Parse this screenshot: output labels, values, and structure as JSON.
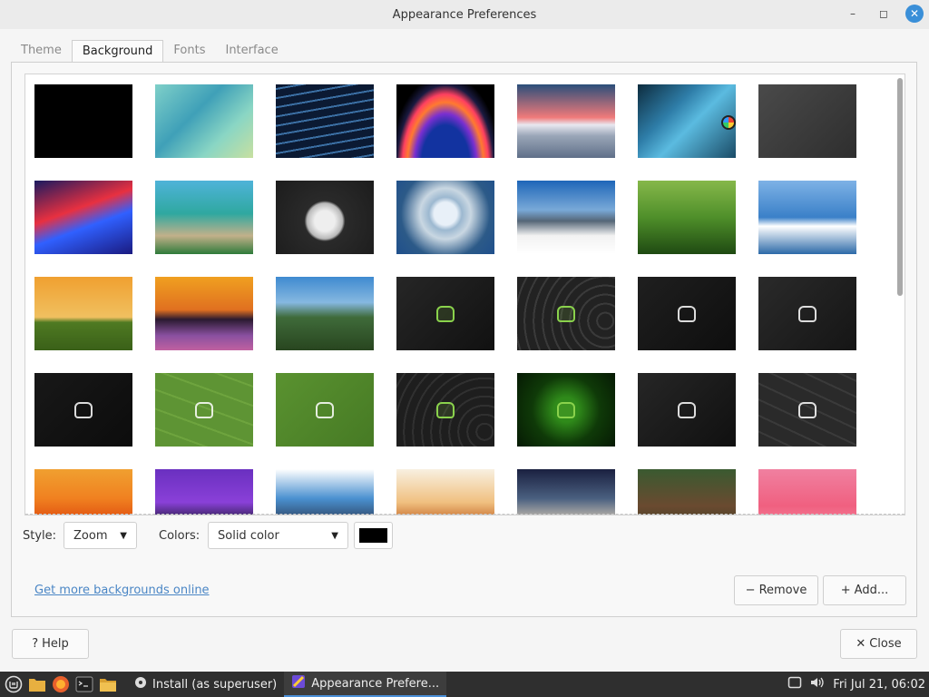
{
  "window": {
    "title": "Appearance Preferences",
    "minimize": "–",
    "maximize": "◻",
    "close": "✕"
  },
  "tabs": [
    {
      "label": "Theme",
      "active": false
    },
    {
      "label": "Background",
      "active": true
    },
    {
      "label": "Fonts",
      "active": false
    },
    {
      "label": "Interface",
      "active": false
    }
  ],
  "thumbnails": [
    {
      "bg": "#000000"
    },
    {
      "bg": "linear-gradient(135deg,#7fd0c9 0%,#3fa0b8 40%,#8ad6c4 70%,#c8e0a0 100%)"
    },
    {
      "bg": "repeating-linear-gradient(170deg,#0b1a33 0 4px,#3b6fa3 4px 6px,#0b1a33 6px 10px)"
    },
    {
      "bg": "radial-gradient(ellipse at 50% 110%,#1233a0 0 35%,#7a2fd0 45%,#ff7a30 55%,#ff4060 62%,#1a1a40 70%,#000 80%)"
    },
    {
      "bg": "linear-gradient(180deg,#2a4e7a 0%,#f07a7a 45%,#e8e8f0 55%,#9aa6b8 70%,#5f6f88 100%)"
    },
    {
      "bg": "linear-gradient(135deg,#0d2c3e 0%,#2e7da8 35%,#5bbbe0 55%,#1a4b66 100%)",
      "badge": true
    },
    {
      "bg": "linear-gradient(135deg,#4a4a4a,#2e2e2e)"
    },
    {
      "bg": "linear-gradient(160deg,#1a1a60 0%,#e83040 40%,#3060ff 60%,#1a1a80 100%)"
    },
    {
      "bg": "linear-gradient(180deg,#4fb3d9 0%,#2fa8a0 45%,#c2b08a 75%,#2e7a3a 100%)"
    },
    {
      "bg": "radial-gradient(circle at 50% 55%,#eeeeee 0 16%,#b8b8b8 28%,#2a2a2a 32%,#1c1c1c 100%)"
    },
    {
      "bg": "radial-gradient(circle at 50% 45%,#e8f0f8 0 18%,#9cb8d0 26%,#c9d7e2 40%,#2c5a88 70%,#1f4f8c 100%)"
    },
    {
      "bg": "linear-gradient(180deg,#1e66b8 0%,#79a9d8 40%,#556677 55%,#f2f2f2 75%,#ffffff 100%)"
    },
    {
      "bg": "linear-gradient(180deg,#86b84a 0%,#4f8f2a 50%,#1f4a12 100%)"
    },
    {
      "bg": "linear-gradient(180deg,#7eb2e6 0%,#3a80c8 50%,#ffffff 62%,#2c6aa8 100%)"
    },
    {
      "bg": "linear-gradient(180deg,#f0a030 0%,#f0c060 55%,#4f7a22 62%,#3a6018 100%)"
    },
    {
      "bg": "linear-gradient(180deg,#f0a020 0%,#e07020 45%,#2a1a30 58%,#8a50a0 80%,#c060a0 100%)"
    },
    {
      "bg": "linear-gradient(180deg,#3f8ad0 0%,#86b8e0 35%,#3f6b3a 55%,#28451f 100%)"
    },
    {
      "bg": "linear-gradient(135deg,#262626,#111)",
      "logo": "green"
    },
    {
      "bg": "repeating-radial-gradient(circle at 90% 60%,#222 0 8px,#3a3a3a 8px 10px)",
      "logo": "green"
    },
    {
      "bg": "linear-gradient(135deg,#1f1f1f,#0e0e0e)",
      "logo": "white"
    },
    {
      "bg": "linear-gradient(135deg,#2a2a2a,#151515)",
      "logo": "white"
    },
    {
      "bg": "linear-gradient(135deg,#181818,#0c0c0c)",
      "logo": "white"
    },
    {
      "bg": "repeating-linear-gradient(20deg,#5e9434 0 18px,#6ea43e 18px 20px)",
      "logo": "white"
    },
    {
      "bg": "linear-gradient(135deg,#5a9230,#467a24)",
      "logo": "white"
    },
    {
      "bg": "repeating-radial-gradient(circle at 90% 80%,#1e1e1e 0 8px,#303030 8px 10px)",
      "logo": "green"
    },
    {
      "bg": "radial-gradient(circle at 50% 50%,#2f8a1a 0 20%,#0f3a08 55%,#061a04 100%)",
      "logo": "green"
    },
    {
      "bg": "linear-gradient(135deg,#262626,#101010)",
      "logo": "white"
    },
    {
      "bg": "repeating-linear-gradient(25deg,#2a2a2a 0 14px,#3a3a3a 14px 16px)",
      "logo": "white"
    },
    {
      "bg": "linear-gradient(180deg,#f0a030 0%,#f08020 40%,#e05010 70%,#f06a10 100%)"
    },
    {
      "bg": "linear-gradient(180deg,#6a30c0 0%,#8a40d8 45%,#1a1a30 75%,#ffffff 100%)"
    },
    {
      "bg": "linear-gradient(180deg,#ffffff 0%,#4a90d0 40%,#2a3a55 75%,#6a8a9a 100%)"
    },
    {
      "bg": "linear-gradient(180deg,#f8f0e0 0%,#f0c080 45%,#d08040 65%,#7a8a9a 100%)"
    },
    {
      "bg": "linear-gradient(180deg,#1a2040 0%,#4a6080 40%,#a0a0a0 60%,#304030 100%)"
    },
    {
      "bg": "linear-gradient(180deg,#3a5a30 0%,#6a4a30 50%,#2a3a20 100%)"
    },
    {
      "bg": "linear-gradient(180deg,#f080a0 0%,#f06080 50%,#f8a0b0 100%)"
    }
  ],
  "style": {
    "label": "Style:",
    "value": "Zoom",
    "arrow": "▼"
  },
  "colors": {
    "label": "Colors:",
    "value": "Solid color",
    "arrow": "▼",
    "swatch": "#000000"
  },
  "more_link": "Get more backgrounds online",
  "buttons": {
    "remove": "Remove",
    "add": "Add...",
    "help": "Help",
    "close": "Close"
  },
  "taskbar": {
    "tasks": [
      {
        "label": "Install (as superuser)",
        "active": false
      },
      {
        "label": "Appearance Prefere...",
        "active": true
      }
    ],
    "clock": "Fri Jul 21, 06:02"
  }
}
